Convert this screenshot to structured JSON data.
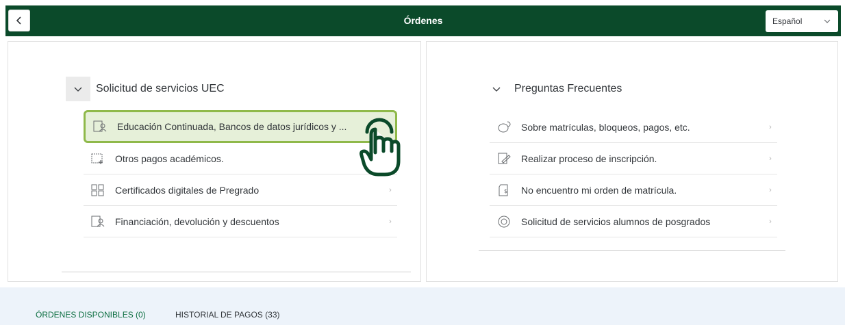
{
  "header": {
    "title": "Órdenes",
    "back_icon": "chevron-left-icon",
    "language": {
      "selected": "Español",
      "icon": "chevron-down-icon"
    }
  },
  "left_panel": {
    "section_title": "Solicitud de servicios UEC",
    "items": [
      {
        "label": "Educación Continuada, Bancos de datos jurídicos y ...",
        "icon": "form-person-icon",
        "highlighted": true
      },
      {
        "label": "Otros pagos académicos.",
        "icon": "add-document-icon"
      },
      {
        "label": "Certificados digitales de Pregrado",
        "icon": "qr-grid-icon",
        "arrow": "›"
      },
      {
        "label": "Financiación, devolución y descuentos",
        "icon": "form-person-icon",
        "arrow": "›"
      }
    ]
  },
  "right_panel": {
    "section_title": "Preguntas Frecuentes",
    "items": [
      {
        "label": "Sobre matrículas, bloqueos, pagos, etc.",
        "icon": "chat-question-icon",
        "arrow": "›"
      },
      {
        "label": "Realizar proceso de inscripción.",
        "icon": "edit-form-icon",
        "arrow": "›"
      },
      {
        "label": "No encuentro mi orden de matrícula.",
        "icon": "document-dollar-icon",
        "arrow": "›"
      },
      {
        "label": "Solicitud de servicios alumnos de posgrados",
        "icon": "cash-circle-icon",
        "arrow": "›"
      }
    ]
  },
  "tabs": [
    {
      "label": "ÓRDENES DISPONIBLES (0)"
    },
    {
      "label": "HISTORIAL DE PAGOS (33)"
    }
  ],
  "colors": {
    "header_bg": "#0b4a2a",
    "highlight_bg": "#e6f0d9",
    "highlight_border": "#8fb94a",
    "hand": "#0b4a2a",
    "tab_active": "#0b6e40",
    "bottom_bg": "#edf3fa"
  }
}
